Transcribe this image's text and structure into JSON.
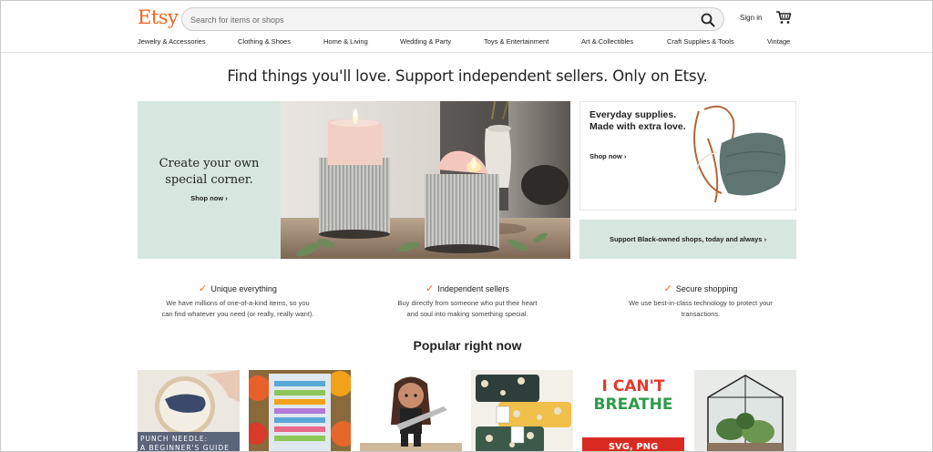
{
  "brand": {
    "logo": "Etsy",
    "accent": "#f1641e",
    "mint": "#d7e6df"
  },
  "header": {
    "search_placeholder": "Search for items or shops",
    "search_icon": "search-icon",
    "signin_label": "Sign in",
    "cart_icon": "cart-icon"
  },
  "categories": [
    "Jewelry & Accessories",
    "Clothing & Shoes",
    "Home & Living",
    "Wedding & Party",
    "Toys & Entertainment",
    "Art & Collectibles",
    "Craft Supplies & Tools",
    "Vintage"
  ],
  "headline": "Find things you'll love. Support independent sellers. Only on Etsy.",
  "hero": {
    "title_line1": "Create your own",
    "title_line2": "special corner.",
    "link": "Shop now"
  },
  "promo": {
    "title": "Everyday supplies. Made with extra love.",
    "link": "Shop now"
  },
  "support": {
    "label": "Support Black-owned shops, today and always"
  },
  "value_props": [
    {
      "title": "Unique everything",
      "line1": "We have millions of one-of-a-kind items, so you",
      "line2": "can find whatever you need (or really, really want)."
    },
    {
      "title": "Independent sellers",
      "line1": "Buy directly from someone who put their heart",
      "line2": "and soul into making something special."
    },
    {
      "title": "Secure shopping",
      "line1": "We use best-in-class technology to protect your",
      "line2": "transactions."
    }
  ],
  "popular_title": "Popular right now",
  "tiles": {
    "t1_line1": "PUNCH NEEDLE:",
    "t1_line2": "A BEGINNER'S GUIDE",
    "t5_line1": "I CAN'T",
    "t5_line2": "BREATHE",
    "t5_line3": "SVG, PNG"
  }
}
